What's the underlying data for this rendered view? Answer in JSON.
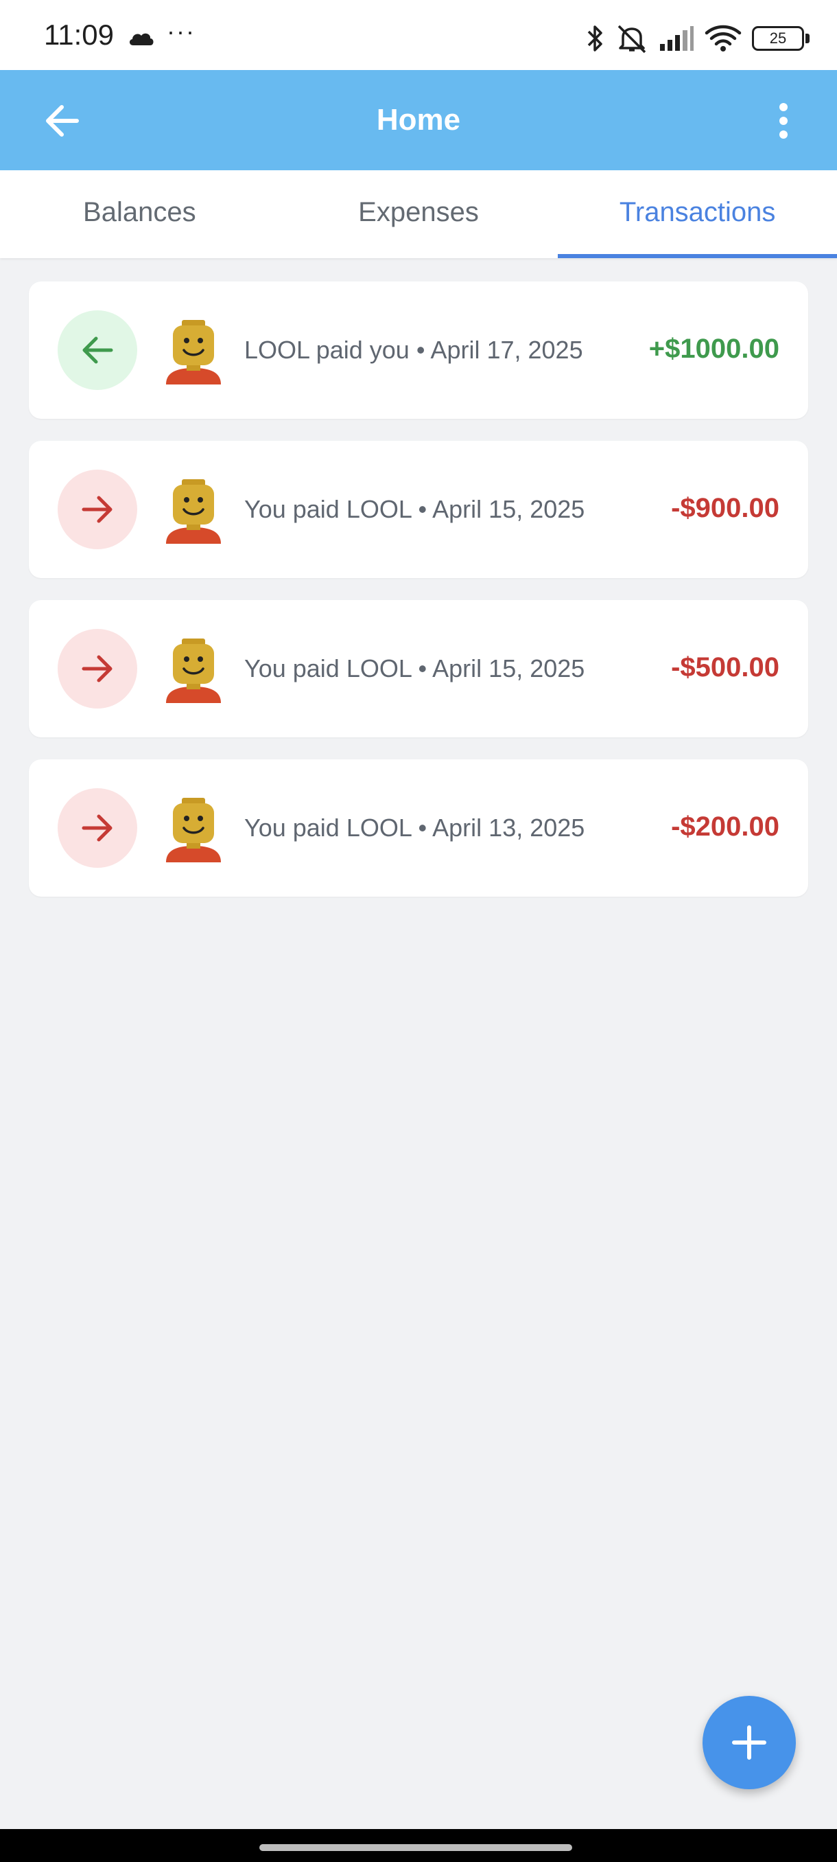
{
  "status_bar": {
    "time": "11:09",
    "dots": "···",
    "battery": "25",
    "icons": [
      "cloud-icon",
      "bluetooth-icon",
      "silent-icon",
      "signal-icon",
      "wifi-icon",
      "battery-icon"
    ]
  },
  "app_bar": {
    "title": "Home",
    "back_icon": "arrow-left-icon",
    "menu_icon": "more-vert-icon"
  },
  "tabs": [
    {
      "label": "Balances",
      "active": false
    },
    {
      "label": "Expenses",
      "active": false
    },
    {
      "label": "Transactions",
      "active": true
    }
  ],
  "transactions": [
    {
      "direction": "in",
      "description": "LOOL paid you • April 17, 2025",
      "amount": "+$1000.00"
    },
    {
      "direction": "out",
      "description": "You paid LOOL • April 15, 2025",
      "amount": "-$900.00"
    },
    {
      "direction": "out",
      "description": "You paid LOOL • April 15, 2025",
      "amount": "-$500.00"
    },
    {
      "direction": "out",
      "description": "You paid LOOL • April 13, 2025",
      "amount": "-$200.00"
    }
  ],
  "colors": {
    "app_bar": "#68baf0",
    "accent": "#4a82e0",
    "incoming": "#3f9a4d",
    "outgoing": "#c53a35",
    "fab": "#4793ea"
  },
  "fab": {
    "icon": "plus-icon"
  }
}
